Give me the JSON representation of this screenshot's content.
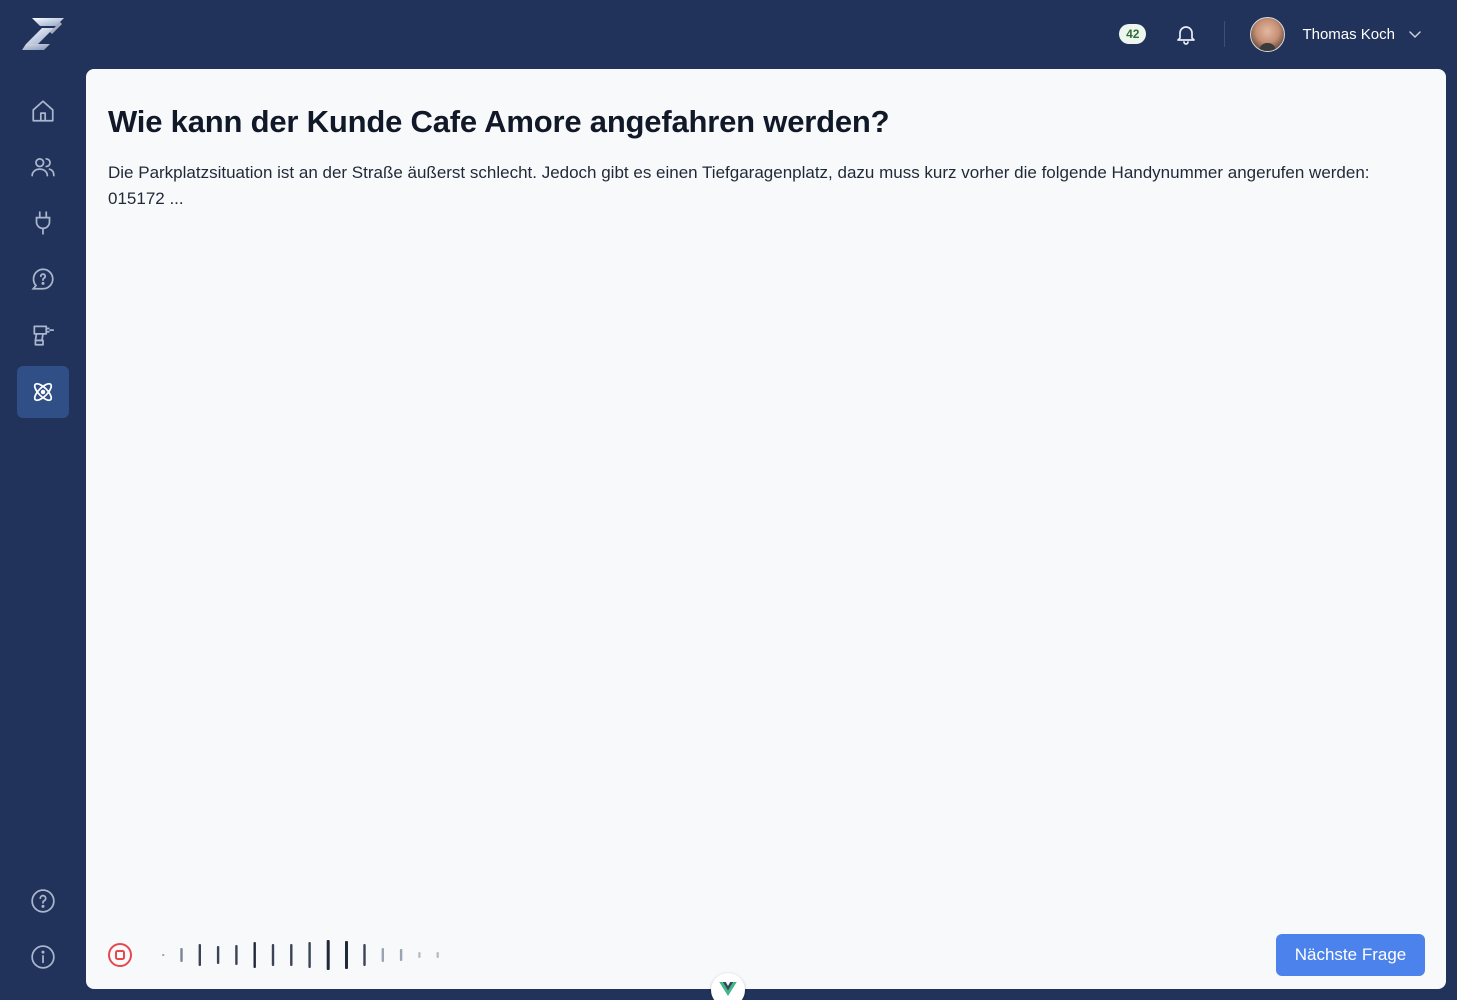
{
  "header": {
    "notification_count": "42",
    "user_name": "Thomas Koch"
  },
  "sidebar": {
    "items": [
      {
        "icon": "home-icon",
        "active": false
      },
      {
        "icon": "users-icon",
        "active": false
      },
      {
        "icon": "plug-icon",
        "active": false
      },
      {
        "icon": "chat-question-icon",
        "active": false
      },
      {
        "icon": "drill-icon",
        "active": false
      },
      {
        "icon": "atom-icon",
        "active": true
      }
    ],
    "bottom_items": [
      {
        "icon": "help-circle-icon"
      },
      {
        "icon": "info-circle-icon"
      }
    ]
  },
  "main": {
    "question": "Wie kann der Kunde Cafe Amore angefahren werden?",
    "answer": "Die Parkplatzsituation ist an der Straße äußerst schlecht. Jedoch gibt es einen Tiefgaragenplatz, dazu muss kurz vorher die folgende Handynummer angerufen werden: 015172 ...",
    "next_button_label": "Nächste Frage"
  },
  "colors": {
    "background": "#21335a",
    "card": "#f8f9fb",
    "accent": "#4c82ec",
    "active_nav": "#2f4f86",
    "record_stop": "#e5484d"
  }
}
